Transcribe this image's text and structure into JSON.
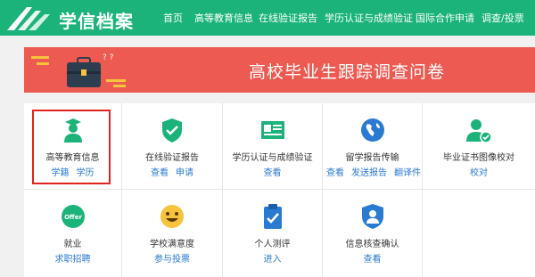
{
  "header": {
    "brand": "学信档案",
    "nav": [
      "首页",
      "高等教育信息",
      "在线验证报告",
      "学历认证与成绩验证",
      "国际合作申请",
      "调查/投票"
    ]
  },
  "banner": {
    "title": "高校毕业生跟踪调查问卷",
    "decor_text": "? ?"
  },
  "tiles": [
    {
      "label": "高等教育信息",
      "links": [
        "学籍",
        "学历"
      ],
      "icon": "graduate-icon"
    },
    {
      "label": "在线验证报告",
      "links": [
        "查看",
        "申请"
      ],
      "icon": "shield-check-icon"
    },
    {
      "label": "学历认证与成绩验证",
      "links": [
        "查看"
      ],
      "icon": "certificate-icon"
    },
    {
      "label": "留学报告传输",
      "links": [
        "查看",
        "发送报告",
        "翻译件"
      ],
      "icon": "globe-icon"
    },
    {
      "label": "毕业证书图像校对",
      "links": [
        "校对"
      ],
      "icon": "user-check-icon"
    },
    {
      "label": "就业",
      "links": [
        "求职招聘"
      ],
      "icon": "offer-icon",
      "badge": "Offer"
    },
    {
      "label": "学校满意度",
      "links": [
        "参与投票"
      ],
      "icon": "smiley-icon"
    },
    {
      "label": "个人测评",
      "links": [
        "进入"
      ],
      "icon": "clipboard-check-icon"
    },
    {
      "label": "信息核查确认",
      "links": [
        "查看"
      ],
      "icon": "user-shield-icon"
    }
  ],
  "colors": {
    "header": "#1bb37a",
    "banner": "#ec5a51",
    "link": "#2a7ad1",
    "highlight": "#e0241f"
  }
}
